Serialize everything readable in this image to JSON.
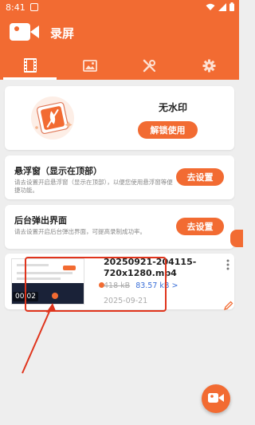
{
  "status_bar": {
    "time": "8:41"
  },
  "app": {
    "title": "录屏"
  },
  "tabs": [
    {
      "icon": "film-icon",
      "active": true
    },
    {
      "icon": "image-icon",
      "active": false
    },
    {
      "icon": "tools-icon",
      "active": false
    },
    {
      "icon": "gear-icon",
      "active": false
    }
  ],
  "watermark_card": {
    "title": "无水印",
    "button": "解锁使用"
  },
  "float_window": {
    "title": "悬浮窗（显示在顶部）",
    "description": "请去设置开启悬浮窗（显示在顶部），以便您使用悬浮窗等便捷功能。",
    "button": "去设置"
  },
  "background_popup": {
    "title": "后台弹出界面",
    "description": "请去设置开启后台弹出界面，可提高录制成功率。",
    "button": "去设置"
  },
  "recording": {
    "filename": "20250921-204115-720x1280.mp4",
    "duration": "00:02",
    "size_original": "418 kB",
    "size_compressed": "83.57 kB >",
    "date": "2025-09-21"
  },
  "colors": {
    "accent": "#f26b32",
    "highlight": "#e0341c",
    "link": "#3a6fd8"
  }
}
